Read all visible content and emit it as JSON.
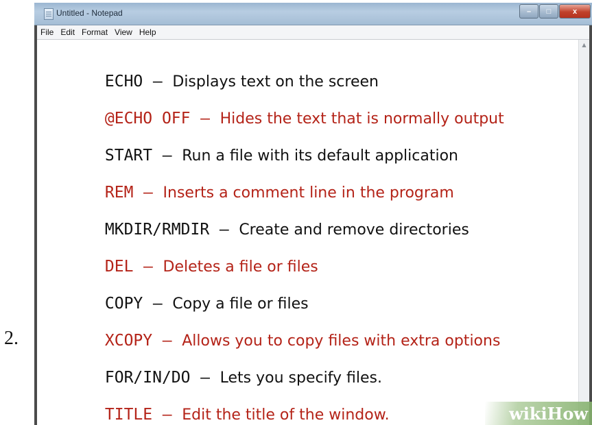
{
  "step_number": "2.",
  "window": {
    "title": "Untitled - Notepad",
    "controls": {
      "minimize": "–",
      "maximize": "□",
      "close": "x"
    }
  },
  "menu": [
    "File",
    "Edit",
    "Format",
    "View",
    "Help"
  ],
  "lines": [
    {
      "cmd": "ECHO",
      "desc": "Displays text on the screen",
      "color": "#111111"
    },
    {
      "cmd": "@ECHO OFF",
      "desc": "Hides the text that is normally output",
      "color": "#b42318"
    },
    {
      "cmd": "START",
      "desc": "Run a file with its default application",
      "color": "#111111"
    },
    {
      "cmd": "REM",
      "desc": "Inserts a comment line in the program",
      "color": "#b42318"
    },
    {
      "cmd": "MKDIR/RMDIR",
      "desc": "Create and remove directories",
      "color": "#111111"
    },
    {
      "cmd": "DEL",
      "desc": "Deletes a file or files",
      "color": "#b42318"
    },
    {
      "cmd": "COPY",
      "desc": "Copy a file or files",
      "color": "#111111"
    },
    {
      "cmd": "XCOPY",
      "desc": "Allows you to copy files with extra options",
      "color": "#b42318"
    },
    {
      "cmd": "FOR/IN/DO",
      "desc": "Lets you specify files.",
      "color": "#111111"
    },
    {
      "cmd": "TITLE",
      "desc": "Edit the title of the window.",
      "color": "#b42318"
    }
  ],
  "separator": "–",
  "watermark": "wikiHow",
  "scroll_up_icon": "triangle-up"
}
